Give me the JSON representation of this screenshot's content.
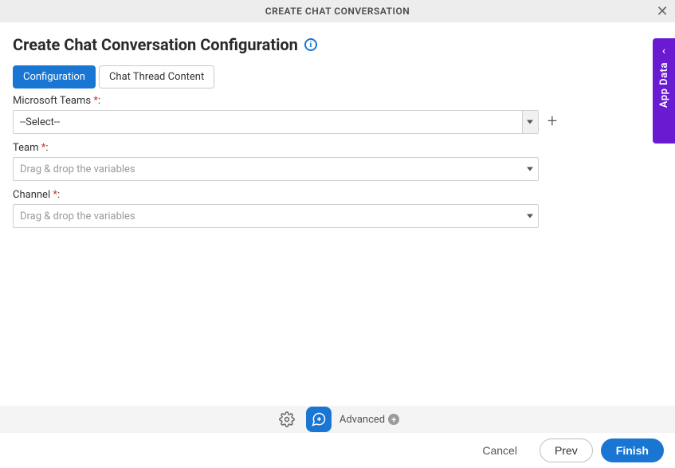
{
  "header": {
    "title": "CREATE CHAT CONVERSATION"
  },
  "page": {
    "title": "Create Chat Conversation Configuration"
  },
  "tabs": {
    "configuration": "Configuration",
    "chat_thread_content": "Chat Thread Content"
  },
  "fields": {
    "ms_teams": {
      "label": "Microsoft Teams",
      "value": "--Select--"
    },
    "team": {
      "label": "Team",
      "placeholder": "Drag & drop the variables"
    },
    "channel": {
      "label": "Channel",
      "placeholder": "Drag & drop the variables"
    }
  },
  "toolbar": {
    "advanced_label": "Advanced"
  },
  "footer": {
    "cancel": "Cancel",
    "prev": "Prev",
    "finish": "Finish"
  },
  "sidepanel": {
    "label": "App Data"
  }
}
